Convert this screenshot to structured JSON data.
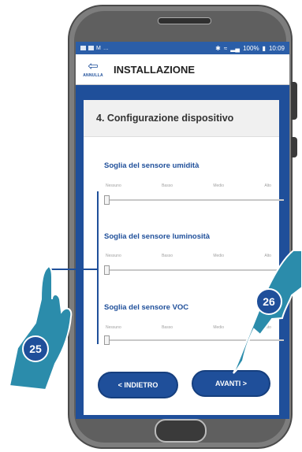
{
  "status_bar": {
    "signal_text": "100%",
    "time": "10:09"
  },
  "header": {
    "back_label": "ANNULLA",
    "title": "INSTALLAZIONE"
  },
  "card": {
    "step_title": "4. Configurazione dispositivo"
  },
  "tick_labels": [
    "Nessuno",
    "Basso",
    "Medio",
    "Alto"
  ],
  "sensors": [
    {
      "label": "Soglia del sensore umidità"
    },
    {
      "label": "Soglia del sensore luminosità"
    },
    {
      "label": "Soglia del sensore VOC"
    }
  ],
  "buttons": {
    "back": "< INDIETRO",
    "next": "AVANTI >"
  },
  "callouts": {
    "left": "25",
    "right": "26"
  },
  "colors": {
    "brand_blue": "#1f4f9a",
    "hand_teal": "#2b8cab"
  }
}
